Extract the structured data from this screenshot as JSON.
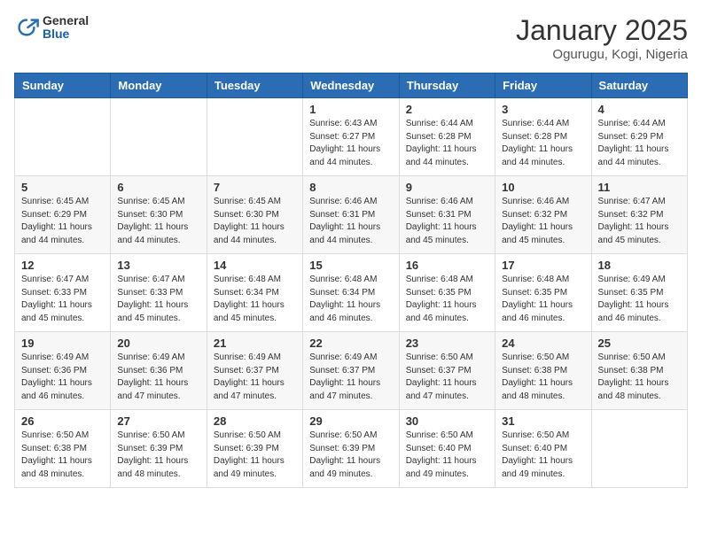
{
  "header": {
    "logo_general": "General",
    "logo_blue": "Blue",
    "month": "January 2025",
    "location": "Ogurugu, Kogi, Nigeria"
  },
  "days_of_week": [
    "Sunday",
    "Monday",
    "Tuesday",
    "Wednesday",
    "Thursday",
    "Friday",
    "Saturday"
  ],
  "weeks": [
    [
      {
        "day": "",
        "info": ""
      },
      {
        "day": "",
        "info": ""
      },
      {
        "day": "",
        "info": ""
      },
      {
        "day": "1",
        "info": "Sunrise: 6:43 AM\nSunset: 6:27 PM\nDaylight: 11 hours\nand 44 minutes."
      },
      {
        "day": "2",
        "info": "Sunrise: 6:44 AM\nSunset: 6:28 PM\nDaylight: 11 hours\nand 44 minutes."
      },
      {
        "day": "3",
        "info": "Sunrise: 6:44 AM\nSunset: 6:28 PM\nDaylight: 11 hours\nand 44 minutes."
      },
      {
        "day": "4",
        "info": "Sunrise: 6:44 AM\nSunset: 6:29 PM\nDaylight: 11 hours\nand 44 minutes."
      }
    ],
    [
      {
        "day": "5",
        "info": "Sunrise: 6:45 AM\nSunset: 6:29 PM\nDaylight: 11 hours\nand 44 minutes."
      },
      {
        "day": "6",
        "info": "Sunrise: 6:45 AM\nSunset: 6:30 PM\nDaylight: 11 hours\nand 44 minutes."
      },
      {
        "day": "7",
        "info": "Sunrise: 6:45 AM\nSunset: 6:30 PM\nDaylight: 11 hours\nand 44 minutes."
      },
      {
        "day": "8",
        "info": "Sunrise: 6:46 AM\nSunset: 6:31 PM\nDaylight: 11 hours\nand 44 minutes."
      },
      {
        "day": "9",
        "info": "Sunrise: 6:46 AM\nSunset: 6:31 PM\nDaylight: 11 hours\nand 45 minutes."
      },
      {
        "day": "10",
        "info": "Sunrise: 6:46 AM\nSunset: 6:32 PM\nDaylight: 11 hours\nand 45 minutes."
      },
      {
        "day": "11",
        "info": "Sunrise: 6:47 AM\nSunset: 6:32 PM\nDaylight: 11 hours\nand 45 minutes."
      }
    ],
    [
      {
        "day": "12",
        "info": "Sunrise: 6:47 AM\nSunset: 6:33 PM\nDaylight: 11 hours\nand 45 minutes."
      },
      {
        "day": "13",
        "info": "Sunrise: 6:47 AM\nSunset: 6:33 PM\nDaylight: 11 hours\nand 45 minutes."
      },
      {
        "day": "14",
        "info": "Sunrise: 6:48 AM\nSunset: 6:34 PM\nDaylight: 11 hours\nand 45 minutes."
      },
      {
        "day": "15",
        "info": "Sunrise: 6:48 AM\nSunset: 6:34 PM\nDaylight: 11 hours\nand 46 minutes."
      },
      {
        "day": "16",
        "info": "Sunrise: 6:48 AM\nSunset: 6:35 PM\nDaylight: 11 hours\nand 46 minutes."
      },
      {
        "day": "17",
        "info": "Sunrise: 6:48 AM\nSunset: 6:35 PM\nDaylight: 11 hours\nand 46 minutes."
      },
      {
        "day": "18",
        "info": "Sunrise: 6:49 AM\nSunset: 6:35 PM\nDaylight: 11 hours\nand 46 minutes."
      }
    ],
    [
      {
        "day": "19",
        "info": "Sunrise: 6:49 AM\nSunset: 6:36 PM\nDaylight: 11 hours\nand 46 minutes."
      },
      {
        "day": "20",
        "info": "Sunrise: 6:49 AM\nSunset: 6:36 PM\nDaylight: 11 hours\nand 47 minutes."
      },
      {
        "day": "21",
        "info": "Sunrise: 6:49 AM\nSunset: 6:37 PM\nDaylight: 11 hours\nand 47 minutes."
      },
      {
        "day": "22",
        "info": "Sunrise: 6:49 AM\nSunset: 6:37 PM\nDaylight: 11 hours\nand 47 minutes."
      },
      {
        "day": "23",
        "info": "Sunrise: 6:50 AM\nSunset: 6:37 PM\nDaylight: 11 hours\nand 47 minutes."
      },
      {
        "day": "24",
        "info": "Sunrise: 6:50 AM\nSunset: 6:38 PM\nDaylight: 11 hours\nand 48 minutes."
      },
      {
        "day": "25",
        "info": "Sunrise: 6:50 AM\nSunset: 6:38 PM\nDaylight: 11 hours\nand 48 minutes."
      }
    ],
    [
      {
        "day": "26",
        "info": "Sunrise: 6:50 AM\nSunset: 6:38 PM\nDaylight: 11 hours\nand 48 minutes."
      },
      {
        "day": "27",
        "info": "Sunrise: 6:50 AM\nSunset: 6:39 PM\nDaylight: 11 hours\nand 48 minutes."
      },
      {
        "day": "28",
        "info": "Sunrise: 6:50 AM\nSunset: 6:39 PM\nDaylight: 11 hours\nand 49 minutes."
      },
      {
        "day": "29",
        "info": "Sunrise: 6:50 AM\nSunset: 6:39 PM\nDaylight: 11 hours\nand 49 minutes."
      },
      {
        "day": "30",
        "info": "Sunrise: 6:50 AM\nSunset: 6:40 PM\nDaylight: 11 hours\nand 49 minutes."
      },
      {
        "day": "31",
        "info": "Sunrise: 6:50 AM\nSunset: 6:40 PM\nDaylight: 11 hours\nand 49 minutes."
      },
      {
        "day": "",
        "info": ""
      }
    ]
  ]
}
